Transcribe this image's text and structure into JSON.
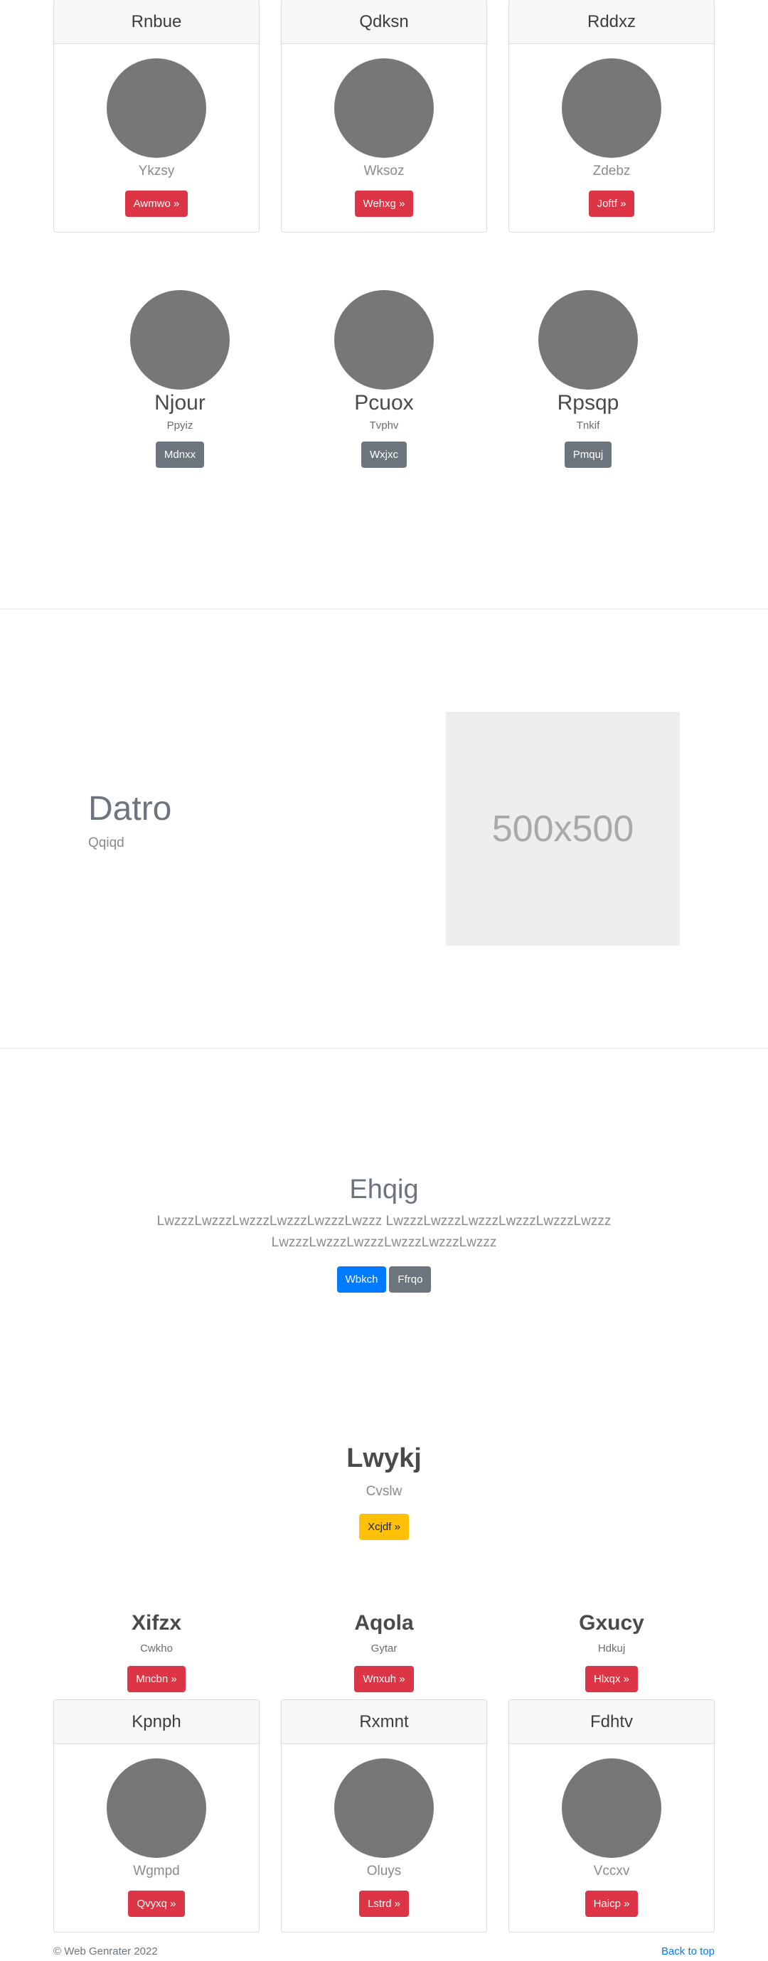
{
  "cards_top": [
    {
      "title": "Rnbue",
      "subtitle": "Ykzsy",
      "button": "Awmwo »"
    },
    {
      "title": "Qdksn",
      "subtitle": "Wksoz",
      "button": "Wehxg »"
    },
    {
      "title": "Rddxz",
      "subtitle": "Zdebz",
      "button": "Joftf »"
    }
  ],
  "team": [
    {
      "name": "Njour",
      "role": "Ppyiz",
      "button": "Mdnxx"
    },
    {
      "name": "Pcuox",
      "role": "Tvphv",
      "button": "Wxjxc"
    },
    {
      "name": "Rpsqp",
      "role": "Tnkif",
      "button": "Pmquj"
    }
  ],
  "feature": {
    "title": "Datro",
    "subtitle": "Qqiqd",
    "image_label": "500x500"
  },
  "hero": {
    "title": "Ehqig",
    "text": "LwzzzLwzzzLwzzzLwzzzLwzzzLwzzz LwzzzLwzzzLwzzzLwzzzLwzzzLwzzz LwzzzLwzzzLwzzzLwzzzLwzzzLwzzz",
    "primary_button": "Wbkch",
    "secondary_button": "Ffrqo"
  },
  "cta": {
    "title": "Lwykj",
    "subtitle": "Cvslw",
    "button": "Xcjdf »"
  },
  "columns": [
    {
      "title": "Xifzx",
      "subtitle": "Cwkho",
      "button": "Mncbn »"
    },
    {
      "title": "Aqola",
      "subtitle": "Gytar",
      "button": "Wnxuh »"
    },
    {
      "title": "Gxucy",
      "subtitle": "Hdkuj",
      "button": "Hlxqx »"
    }
  ],
  "cards_bottom": [
    {
      "title": "Kpnph",
      "subtitle": "Wgmpd",
      "button": "Qvyxq »"
    },
    {
      "title": "Rxmnt",
      "subtitle": "Oluys",
      "button": "Lstrd »"
    },
    {
      "title": "Fdhtv",
      "subtitle": "Vccxv",
      "button": "Haicp »"
    }
  ],
  "footer": {
    "copyright": "© Web Genrater 2022",
    "back_to_top": "Back to top"
  }
}
